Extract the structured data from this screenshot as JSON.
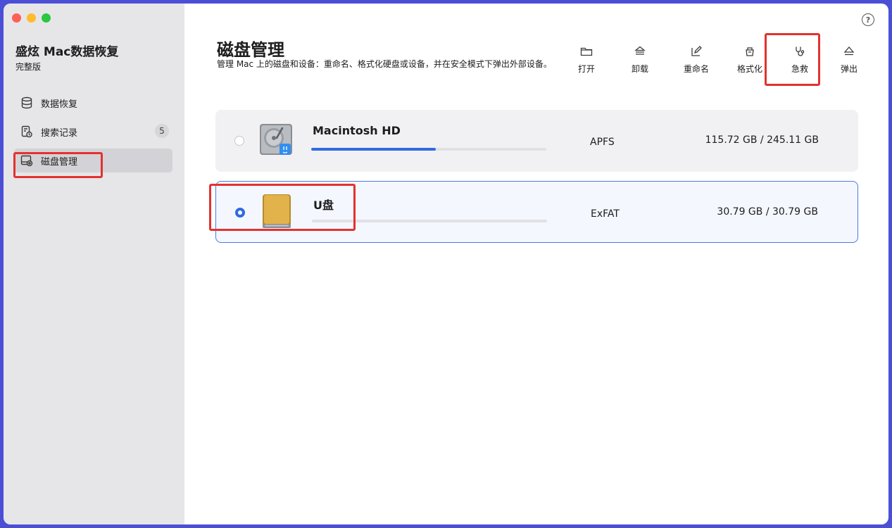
{
  "app": {
    "title": "盛炫 Mac数据恢复",
    "edition": "完整版"
  },
  "sidebar": {
    "items": [
      {
        "label": "数据恢复",
        "icon": "database-icon",
        "badge": ""
      },
      {
        "label": "搜索记录",
        "icon": "history-icon",
        "badge": "5"
      },
      {
        "label": "磁盘管理",
        "icon": "disk-manage-icon",
        "badge": "",
        "active": true
      }
    ]
  },
  "header": {
    "title": "磁盘管理",
    "description": "管理 Mac 上的磁盘和设备：重命名、格式化硬盘或设备，并在安全模式下弹出外部设备。",
    "help_icon": "help-icon",
    "help_glyph": "?"
  },
  "toolbar": {
    "items": [
      {
        "label": "打开",
        "icon": "folder-open-icon"
      },
      {
        "label": "卸载",
        "icon": "unmount-icon"
      },
      {
        "label": "重命名",
        "icon": "rename-icon"
      },
      {
        "label": "格式化",
        "icon": "format-icon"
      },
      {
        "label": "急救",
        "icon": "first-aid-icon"
      },
      {
        "label": "弹出",
        "icon": "eject-icon"
      }
    ]
  },
  "disks": [
    {
      "name": "Macintosh HD",
      "filesystem": "APFS",
      "size": "115.72 GB / 245.11 GB",
      "used_fraction": 0.53,
      "selected": false,
      "icon": "internal-hdd-icon"
    },
    {
      "name": "U盘",
      "filesystem": "ExFAT",
      "size": "30.79 GB / 30.79 GB",
      "used_fraction": 0.0,
      "selected": true,
      "icon": "external-drive-icon"
    }
  ],
  "colors": {
    "accent": "#2f6be0",
    "highlight": "#e3322f",
    "sidebar_bg": "#e6e6e8"
  }
}
